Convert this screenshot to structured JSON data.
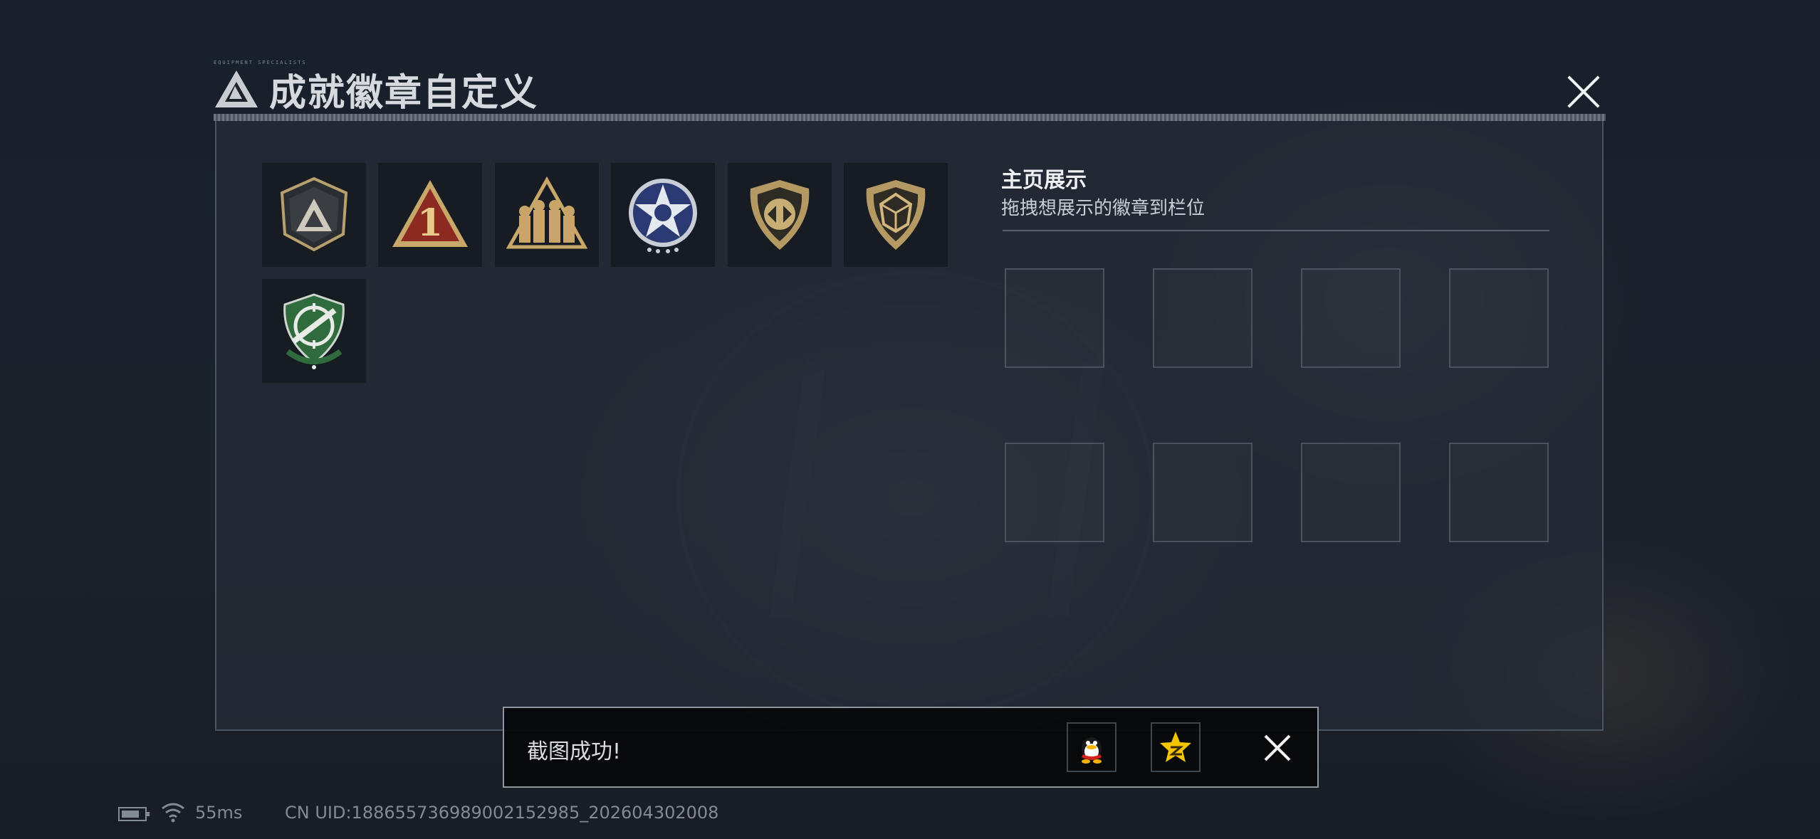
{
  "window": {
    "title": "成就徽章自定义",
    "tagline": "EQUIPMENT SPECIALISTS"
  },
  "badges": [
    {
      "name": "delta-logo-shield-badge"
    },
    {
      "name": "number-one-triangle-badge"
    },
    {
      "name": "soldiers-triangle-badge"
    },
    {
      "name": "star-eagle-badge"
    },
    {
      "name": "gold-shield-arrows-badge"
    },
    {
      "name": "polyhedron-shield-badge"
    },
    {
      "name": "green-crosshair-shield-badge"
    }
  ],
  "display_section": {
    "title": "主页展示",
    "subtitle": "拖拽想展示的徽章到栏位",
    "slot_count": 8
  },
  "toast": {
    "message": "截图成功!",
    "share_targets": [
      "qq-icon",
      "qzone-star-icon"
    ]
  },
  "status_bar": {
    "latency": "55ms",
    "uid": "CN UID:18865573698900215​2985_202604302008"
  },
  "colors": {
    "accent_gold": "#c8a86a",
    "accent_red": "#8c2a22",
    "accent_green": "#2f6b3c",
    "accent_blue": "#2b3a72"
  }
}
